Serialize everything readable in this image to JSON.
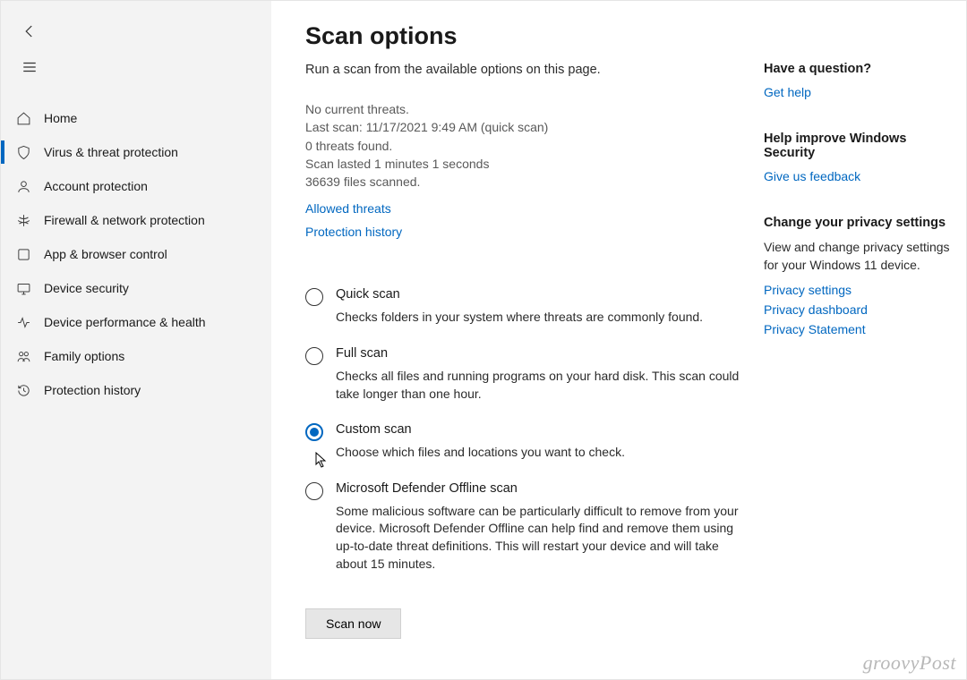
{
  "sidebar": {
    "items": [
      {
        "label": "Home",
        "icon": "home-icon",
        "selected": false
      },
      {
        "label": "Virus & threat protection",
        "icon": "shield-icon",
        "selected": true
      },
      {
        "label": "Account protection",
        "icon": "account-icon",
        "selected": false
      },
      {
        "label": "Firewall & network protection",
        "icon": "network-icon",
        "selected": false
      },
      {
        "label": "App & browser control",
        "icon": "app-icon",
        "selected": false
      },
      {
        "label": "Device security",
        "icon": "device-icon",
        "selected": false
      },
      {
        "label": "Device performance & health",
        "icon": "performance-icon",
        "selected": false
      },
      {
        "label": "Family options",
        "icon": "family-icon",
        "selected": false
      },
      {
        "label": "Protection history",
        "icon": "history-icon",
        "selected": false
      }
    ]
  },
  "page": {
    "title": "Scan options",
    "subtitle": "Run a scan from the available options on this page.",
    "status": {
      "no_threats": "No current threats.",
      "last_scan": "Last scan: 11/17/2021 9:49 AM (quick scan)",
      "threats_found": "0 threats found.",
      "duration": "Scan lasted 1 minutes 1 seconds",
      "files_scanned": "36639 files scanned."
    },
    "links": {
      "allowed_threats": "Allowed threats",
      "protection_history": "Protection history"
    },
    "options": [
      {
        "title": "Quick scan",
        "desc": "Checks folders in your system where threats are commonly found.",
        "checked": false
      },
      {
        "title": "Full scan",
        "desc": "Checks all files and running programs on your hard disk. This scan could take longer than one hour.",
        "checked": false
      },
      {
        "title": "Custom scan",
        "desc": "Choose which files and locations you want to check.",
        "checked": true
      },
      {
        "title": "Microsoft Defender Offline scan",
        "desc": "Some malicious software can be particularly difficult to remove from your device. Microsoft Defender Offline can help find and remove them using up-to-date threat definitions. This will restart your device and will take about 15 minutes.",
        "checked": false
      }
    ],
    "scan_button": "Scan now"
  },
  "rail": {
    "question": {
      "heading": "Have a question?",
      "link": "Get help"
    },
    "improve": {
      "heading": "Help improve Windows Security",
      "link": "Give us feedback"
    },
    "privacy": {
      "heading": "Change your privacy settings",
      "text": "View and change privacy settings for your Windows 11 device.",
      "links": [
        "Privacy settings",
        "Privacy dashboard",
        "Privacy Statement"
      ]
    }
  },
  "watermark": "groovyPost"
}
